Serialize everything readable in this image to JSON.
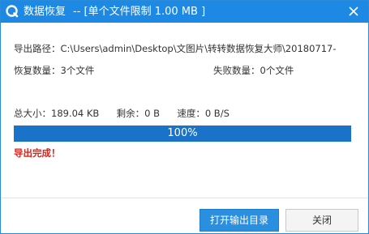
{
  "window": {
    "title_app": "数据恢复",
    "title_limit": "-- [单个文件限制 1.00 MB ]",
    "accent_color": "#1e88e5"
  },
  "info": {
    "export_path_label": "导出路径：",
    "export_path_value": "C:\\Users\\admin\\Desktop\\文图片\\转转数据恢复大师\\20180717-",
    "recovered_label": "恢复数量：",
    "recovered_value": "3个文件",
    "failed_label": "失败数量：",
    "failed_value": "0个文件"
  },
  "stats": {
    "total_label": "总大小：",
    "total_value": "189.04 KB",
    "remaining_label": "剩余：",
    "remaining_value": "0 B",
    "speed_label": "速度：",
    "speed_value": "0 B/S"
  },
  "progress": {
    "percent": 100,
    "text": "100%"
  },
  "status": {
    "text": "导出完成！",
    "color": "#d9251c"
  },
  "buttons": {
    "open_dir_label": "打开输出目录",
    "close_label": "关闭"
  }
}
